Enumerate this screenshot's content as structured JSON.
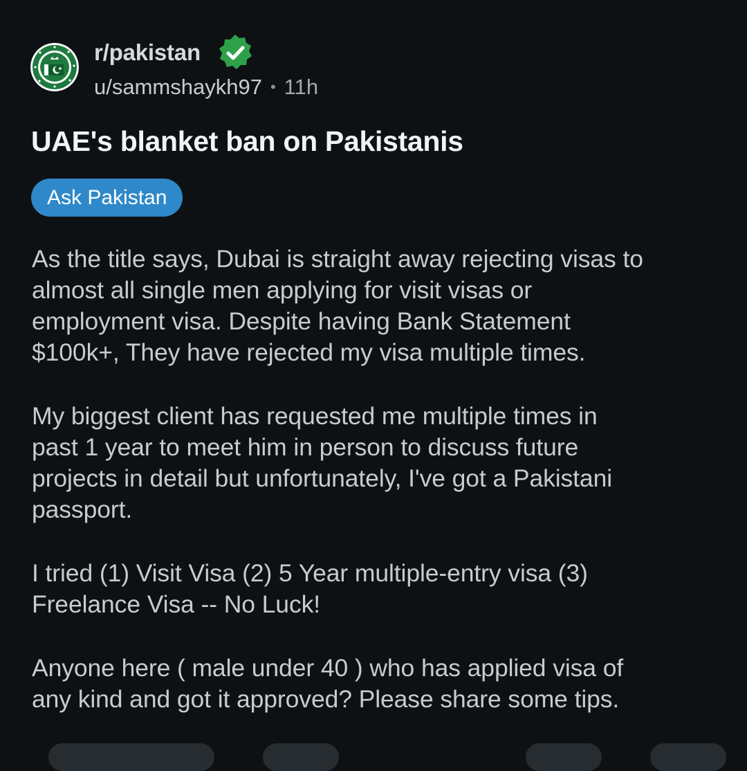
{
  "header": {
    "subreddit": "r/pakistan",
    "username": "u/sammshaykh97",
    "separator": "•",
    "age": "11h",
    "verified_icon": "verified-check-icon",
    "avatar_icon": "subreddit-avatar-icon"
  },
  "post": {
    "title": "UAE's blanket ban on Pakistanis",
    "flair": "Ask Pakistan",
    "paragraphs": [
      {
        "lines": [
          "As the title says, Dubai is straight away rejecting visas to",
          "almost all single men applying for visit visas or",
          "employment visa. Despite having Bank Statement",
          "$100k+, They have rejected my visa multiple times."
        ]
      },
      {
        "lines": [
          "My biggest client has requested me multiple times in",
          "past 1 year to meet him in person to discuss future",
          "projects in detail but unfortunately, I've got a Pakistani",
          "passport."
        ]
      },
      {
        "lines": [
          "I tried (1) Visit Visa (2) 5 Year multiple-entry visa (3)",
          "Freelance Visa -- No Luck!"
        ]
      },
      {
        "lines": [
          "Anyone here ( male under 40 ) who has applied visa of",
          "any kind and got it approved? Please share some tips."
        ]
      }
    ]
  },
  "colors": {
    "background": "#0e1113",
    "flair_bg": "#2f88c9",
    "verified_green": "#2fa04a",
    "avatar_green": "#1b6b3a"
  }
}
